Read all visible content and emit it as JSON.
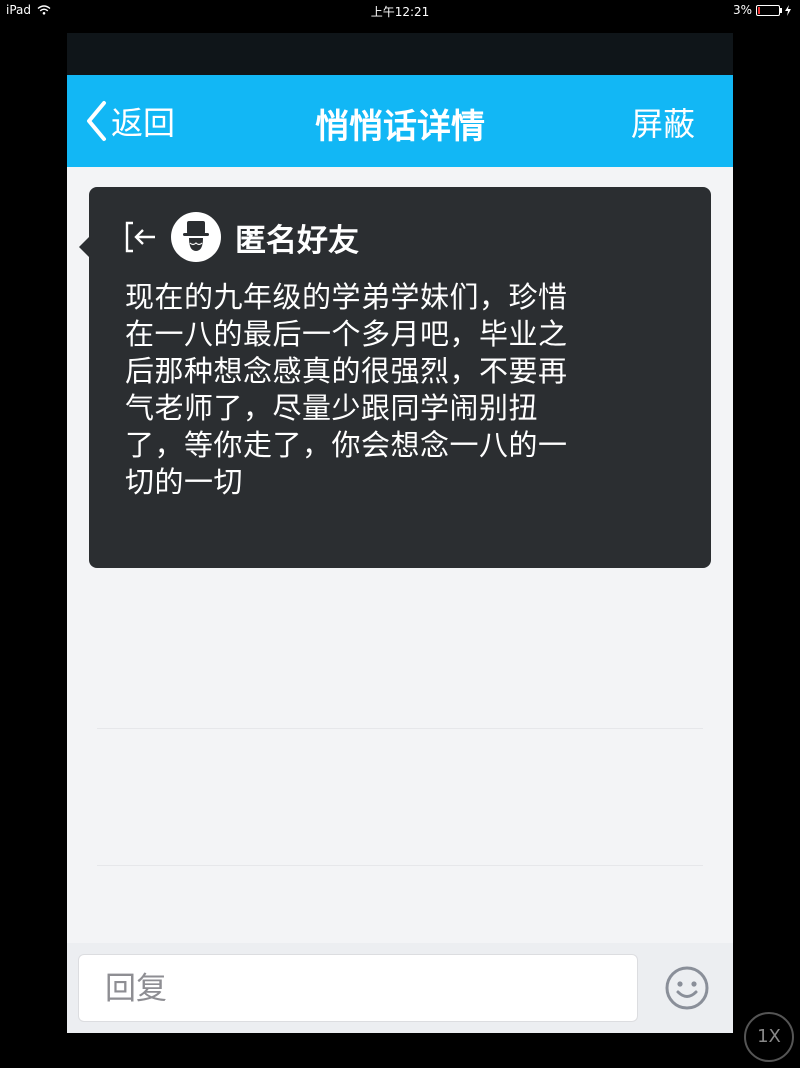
{
  "status_bar": {
    "device": "iPad",
    "time": "上午12:21",
    "battery": "3%"
  },
  "nav": {
    "back_label": "返回",
    "title": "悄悄话详情",
    "block_label": "屏蔽"
  },
  "message": {
    "sender": "匿名好友",
    "lines": [
      "现在的九年级的学弟学妹们，珍惜",
      "在一八的最后一个多月吧，毕业之",
      "后那种想念感真的很强烈，不要再",
      "气老师了，尽量少跟同学闹别扭",
      "了，等你走了，你会想念一八的一",
      "切的一切"
    ]
  },
  "reply": {
    "placeholder": "回复"
  },
  "zoom": {
    "label": "1X"
  },
  "colors": {
    "nav_bg": "#12b7f5",
    "card_bg": "#2b2e31",
    "page_bg": "#f3f4f6"
  },
  "icons": {
    "back": "chevron-left-icon",
    "exit": "exit-arrow-icon",
    "avatar": "anonymous-hat-avatar-icon",
    "emoji": "smiley-icon",
    "wifi": "wifi-icon",
    "battery": "battery-icon"
  }
}
